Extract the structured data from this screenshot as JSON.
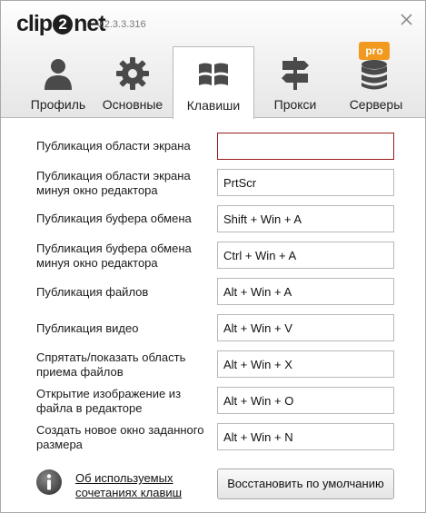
{
  "app": {
    "logo": {
      "before": "clip",
      "digit": "2",
      "after": "net"
    },
    "version": "v.2.3.3.316"
  },
  "tabs": [
    {
      "label": "Профиль",
      "icon": "profile-icon"
    },
    {
      "label": "Основные",
      "icon": "gear-icon"
    },
    {
      "label": "Клавиши",
      "icon": "windows-keys-icon",
      "active": true
    },
    {
      "label": "Прокси",
      "icon": "signpost-icon"
    },
    {
      "label": "Серверы",
      "icon": "database-icon",
      "badge": "pro"
    }
  ],
  "hotkeys": [
    {
      "label": "Публикация области экрана",
      "value": ""
    },
    {
      "label": "Публикация области экрана минуя окно редактора",
      "value": "PrtScr"
    },
    {
      "label": "Публикация буфера обмена",
      "value": "Shift + Win + A"
    },
    {
      "label": "Публикация буфера обмена минуя окно редактора",
      "value": "Ctrl + Win + A"
    },
    {
      "label": "Публикация файлов",
      "value": "Alt + Win + A"
    },
    {
      "label": "Публикация видео",
      "value": "Alt + Win + V"
    },
    {
      "label": "Спрятать/показать область приема файлов",
      "value": "Alt + Win + X"
    },
    {
      "label": "Открытие изображение из файла в редакторе",
      "value": "Alt + Win + O"
    },
    {
      "label": "Создать новое окно заданного размера",
      "value": "Alt + Win + N"
    }
  ],
  "footer": {
    "info_link": "Об используемых сочетаниях клавиш",
    "restore_button": "Восстановить по умолчанию"
  },
  "colors": {
    "pro_badge": "#f29a1f",
    "invalid_border": "#9b1c1c",
    "icon_dark": "#4a4a4a"
  }
}
